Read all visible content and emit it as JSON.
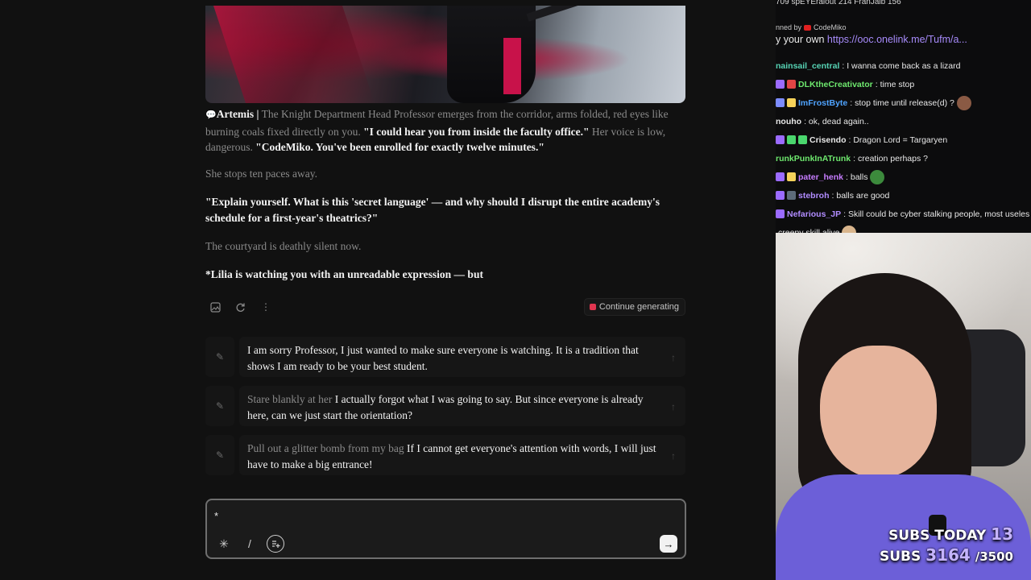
{
  "story": {
    "speaker": "Artemis |",
    "p1_narr1": "The Knight Department Head Professor emerges from the corridor, arms folded, red eyes like burning coals fixed directly on you.",
    "p1_quote1": "\"I could hear you from inside the faculty office.\"",
    "p1_narr2": "Her voice is low, dangerous.",
    "p1_quote2": "\"CodeMiko. You've been enrolled for exactly twelve minutes.\"",
    "p2": "She stops ten paces away.",
    "p3": "\"Explain yourself. What is this 'secret language' — and why should I disrupt the entire academy's schedule for a first-year's theatrics?\"",
    "p4": "The courtyard is deathly silent now.",
    "p5": "*Lilia is watching you with an unreadable expression — but"
  },
  "actions": {
    "continue_label": "Continue generating",
    "icons": [
      "image-icon",
      "regenerate-icon",
      "more-icon"
    ]
  },
  "suggestions": [
    {
      "action": "",
      "text": "I am sorry Professor, I just wanted to make sure everyone is watching. It is a tradition that shows I am ready to be your best student."
    },
    {
      "action": "Stare blankly at her",
      "text": "I actually forgot what I was going to say. But since everyone is already here, can we just start the orientation?"
    },
    {
      "action": "Pull out a glitter bomb from my bag",
      "text": "If I cannot get everyone's attention with words, I will just have to make a big entrance!"
    }
  ],
  "composer": {
    "value": "*",
    "placeholder": ""
  },
  "stream": {
    "topbar": "709   spEYEralout  214   FranJaib  156",
    "pinned_by": "nned by",
    "pinned_author": "CodeMiko",
    "pinned_text": "y your own ",
    "pinned_link": "https://ooc.onelink.me/Tufm/a...",
    "chat": [
      {
        "user": "nainsail_central",
        "color": "#57d4b5",
        "msg": ": I wanna come back as a lizard",
        "badges": [],
        "emote": ""
      },
      {
        "user": "DLKtheCreativator",
        "color": "#6ee86e",
        "msg": ": time stop",
        "badges": [
          "#9b6bff",
          "#e04545"
        ],
        "emote": ""
      },
      {
        "user": "ImFrostByte",
        "color": "#4fa3ff",
        "msg": ": stop time until release(d) ?",
        "badges": [
          "#7c8cff",
          "#f5d25a"
        ],
        "emote": "#8a5a44"
      },
      {
        "user": "nouho",
        "color": "#e8e8e8",
        "msg": ": ok, dead again..",
        "badges": [],
        "emote": ""
      },
      {
        "user": "Crisendo",
        "color": "#e8e8e8",
        "msg": ": Dragon Lord = Targaryen",
        "badges": [
          "#9b6bff",
          "#4ad66d",
          "#4ad66d"
        ],
        "emote": ""
      },
      {
        "user": "runkPunkInATrunk",
        "color": "#6ee86e",
        "msg": ": creation perhaps ?",
        "badges": [],
        "emote": ""
      },
      {
        "user": "pater_henk",
        "color": "#c77dff",
        "msg": ": balls",
        "badges": [
          "#9b6bff",
          "#f5d25a"
        ],
        "emote": "#3c8a3c"
      },
      {
        "user": "stebroh",
        "color": "#b18cff",
        "msg": ": balls are good",
        "badges": [
          "#9b6bff",
          "#5d6b7a"
        ],
        "emote": ""
      },
      {
        "user": "Nefarious_JP",
        "color": "#b18cff",
        "msg": ": Skill could be cyber stalking people, most useles",
        "badges": [
          "#9b6bff"
        ],
        "emote": ""
      },
      {
        "user": "",
        "color": "#e8e8e8",
        "msg": "creepy skill alive",
        "badges": [],
        "emote": "#d9b58c"
      }
    ],
    "subs_today_label": "SUBS TODAY",
    "subs_today": "13",
    "subs_label": "SUBS",
    "subs_total": "3164",
    "subs_goal": "/3500"
  }
}
